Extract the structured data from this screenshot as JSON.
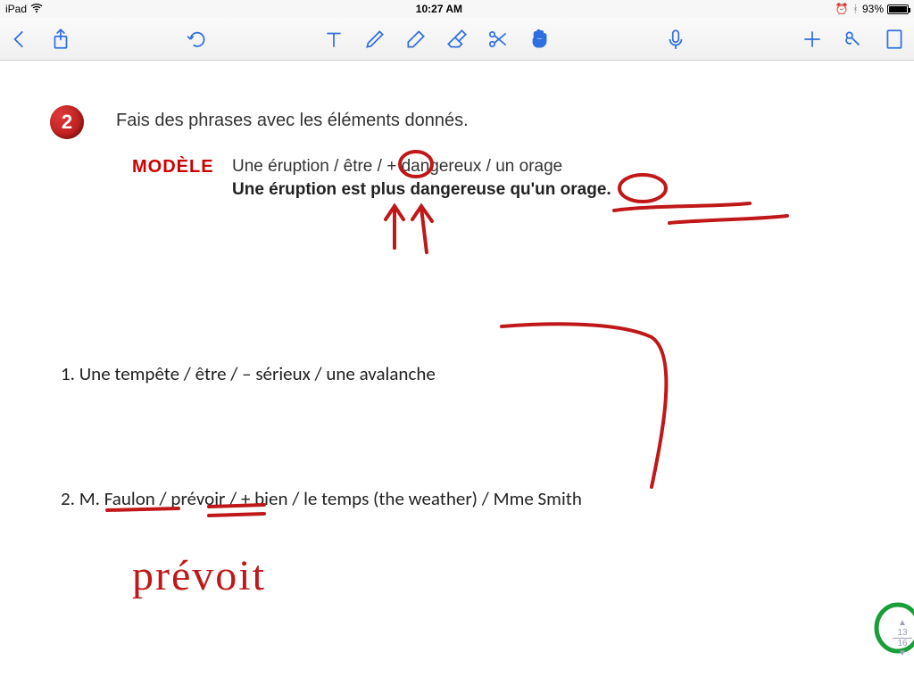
{
  "statusbar": {
    "device": "iPad",
    "time": "10:27 AM",
    "battery_pct": "93%"
  },
  "toolbar": {
    "back": "Back",
    "share": "Share",
    "undo": "Undo",
    "text_tool": "Text",
    "pen": "Pen",
    "highlighter": "Highlighter",
    "eraser": "Eraser",
    "scissors": "Lasso",
    "hand": "Hand",
    "mic": "Microphone",
    "add": "Add",
    "settings": "Settings",
    "pages": "Pages"
  },
  "exercise": {
    "number": "2",
    "instruction": "Fais des phrases avec les éléments donnés.",
    "modele_label": "MODÈLE",
    "modele_prompt": "Une éruption / être / + dangereux / un orage",
    "modele_answer": "Une éruption est plus dangereuse qu'un orage.",
    "q1_text": "1.   Une tempête / être / – sérieux / une avalanche",
    "q2_text": "2. M. Faulon / prévoir / + bien / le temps (the weather)  / Mme Smith"
  },
  "handwriting": {
    "word": "prévoit"
  },
  "page_nav": {
    "current": "13",
    "total": "16"
  },
  "colors": {
    "ink": "#c01818",
    "green": "#1a9e3a"
  }
}
